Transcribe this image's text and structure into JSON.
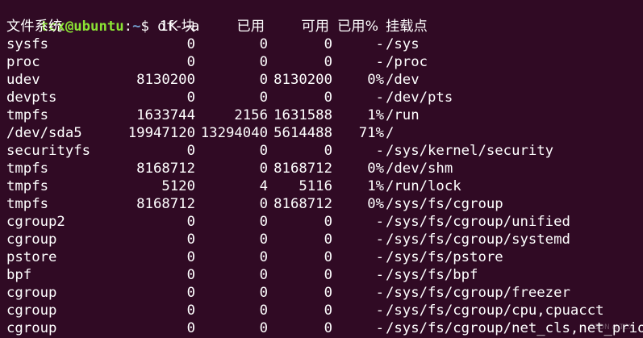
{
  "prompt": {
    "user_host": "tcx@ubuntu",
    "sep": ":",
    "path": "~",
    "dollar": "$ ",
    "command": "df -a"
  },
  "header": {
    "filesystem": "文件系统",
    "blocks": "1K-块",
    "used": "已用",
    "available": "可用",
    "use_pct": "已用%",
    "mounted_on": "挂载点"
  },
  "rows": [
    {
      "fs": "sysfs",
      "blocks": "0",
      "used": "0",
      "avail": "0",
      "pct": "-",
      "mount": "/sys"
    },
    {
      "fs": "proc",
      "blocks": "0",
      "used": "0",
      "avail": "0",
      "pct": "-",
      "mount": "/proc"
    },
    {
      "fs": "udev",
      "blocks": "8130200",
      "used": "0",
      "avail": "8130200",
      "pct": "0%",
      "mount": "/dev"
    },
    {
      "fs": "devpts",
      "blocks": "0",
      "used": "0",
      "avail": "0",
      "pct": "-",
      "mount": "/dev/pts"
    },
    {
      "fs": "tmpfs",
      "blocks": "1633744",
      "used": "2156",
      "avail": "1631588",
      "pct": "1%",
      "mount": "/run"
    },
    {
      "fs": "/dev/sda5",
      "blocks": "19947120",
      "used": "13294040",
      "avail": "5614488",
      "pct": "71%",
      "mount": "/"
    },
    {
      "fs": "securityfs",
      "blocks": "0",
      "used": "0",
      "avail": "0",
      "pct": "-",
      "mount": "/sys/kernel/security"
    },
    {
      "fs": "tmpfs",
      "blocks": "8168712",
      "used": "0",
      "avail": "8168712",
      "pct": "0%",
      "mount": "/dev/shm"
    },
    {
      "fs": "tmpfs",
      "blocks": "5120",
      "used": "4",
      "avail": "5116",
      "pct": "1%",
      "mount": "/run/lock"
    },
    {
      "fs": "tmpfs",
      "blocks": "8168712",
      "used": "0",
      "avail": "8168712",
      "pct": "0%",
      "mount": "/sys/fs/cgroup"
    },
    {
      "fs": "cgroup2",
      "blocks": "0",
      "used": "0",
      "avail": "0",
      "pct": "-",
      "mount": "/sys/fs/cgroup/unified"
    },
    {
      "fs": "cgroup",
      "blocks": "0",
      "used": "0",
      "avail": "0",
      "pct": "-",
      "mount": "/sys/fs/cgroup/systemd"
    },
    {
      "fs": "pstore",
      "blocks": "0",
      "used": "0",
      "avail": "0",
      "pct": "-",
      "mount": "/sys/fs/pstore"
    },
    {
      "fs": "bpf",
      "blocks": "0",
      "used": "0",
      "avail": "0",
      "pct": "-",
      "mount": "/sys/fs/bpf"
    },
    {
      "fs": "cgroup",
      "blocks": "0",
      "used": "0",
      "avail": "0",
      "pct": "-",
      "mount": "/sys/fs/cgroup/freezer"
    },
    {
      "fs": "cgroup",
      "blocks": "0",
      "used": "0",
      "avail": "0",
      "pct": "-",
      "mount": "/sys/fs/cgroup/cpu,cpuacct"
    },
    {
      "fs": "cgroup",
      "blocks": "0",
      "used": "0",
      "avail": "0",
      "pct": "-",
      "mount": "/sys/fs/cgroup/net_cls,net_prio"
    }
  ],
  "watermark": "CSDN @TCX",
  "colors": {
    "background": "#300a24",
    "prompt_user": "#8ae234",
    "prompt_path": "#729fcf",
    "text": "#ffffff"
  }
}
